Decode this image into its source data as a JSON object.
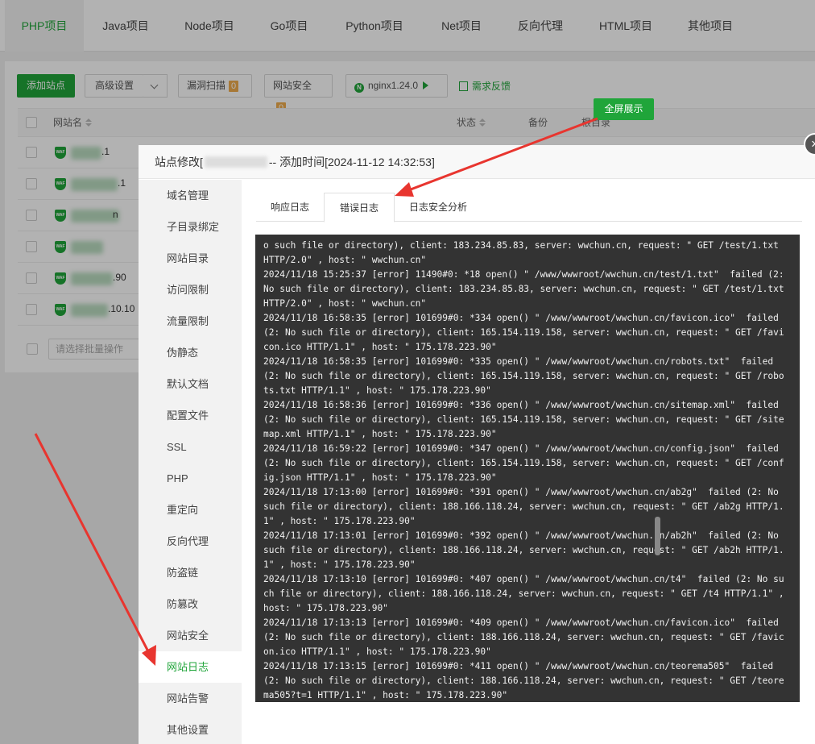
{
  "top_tabs": [
    {
      "label": "PHP项目"
    },
    {
      "label": "Java项目"
    },
    {
      "label": "Node项目"
    },
    {
      "label": "Go项目"
    },
    {
      "label": "Python项目"
    },
    {
      "label": "Net项目"
    },
    {
      "label": "反向代理"
    },
    {
      "label": "HTML项目"
    },
    {
      "label": "其他项目"
    }
  ],
  "toolbar": {
    "add_site": "添加站点",
    "advanced": "高级设置",
    "vuln_scan": "漏洞扫描",
    "vuln_count": "0",
    "site_security": "网站安全",
    "security_count": "0",
    "nginx": "nginx1.24.0",
    "feedback": "需求反馈"
  },
  "table_headers": {
    "name": "网站名",
    "status": "状态",
    "backup": "备份",
    "root": "根目录"
  },
  "site_rows": [
    {
      "suffix": ".1"
    },
    {
      "suffix": ".1"
    },
    {
      "suffix": "n"
    },
    {
      "suffix": ""
    },
    {
      "suffix": ".90"
    },
    {
      "suffix": ".10.10"
    }
  ],
  "batch_placeholder": "请选择批量操作",
  "modal": {
    "title_prefix": "站点修改[",
    "title_suffix": "-- 添加时间[2024-11-12 14:32:53]",
    "close_symbol": "×",
    "side_menu": [
      {
        "label": "域名管理"
      },
      {
        "label": "子目录绑定"
      },
      {
        "label": "网站目录"
      },
      {
        "label": "访问限制"
      },
      {
        "label": "流量限制"
      },
      {
        "label": "伪静态"
      },
      {
        "label": "默认文档"
      },
      {
        "label": "配置文件"
      },
      {
        "label": "SSL"
      },
      {
        "label": "PHP"
      },
      {
        "label": "重定向"
      },
      {
        "label": "反向代理"
      },
      {
        "label": "防盗链"
      },
      {
        "label": "防篡改"
      },
      {
        "label": "网站安全"
      },
      {
        "label": "网站日志"
      },
      {
        "label": "网站告警"
      },
      {
        "label": "其他设置"
      }
    ],
    "active_side_item": "网站日志",
    "log_tabs": [
      {
        "label": "响应日志"
      },
      {
        "label": "错误日志"
      },
      {
        "label": "日志安全分析"
      }
    ],
    "fullscreen": "全屏展示",
    "log_lines": [
      "o such file or directory), client: 183.234.85.83, server: wwchun.cn, request: \" GET /test/1.txt HTTP/2.0\" , host: \" wwchun.cn\"",
      "2024/11/18 15:25:37 [error] 11490#0: *18 open() \" /www/wwwroot/wwchun.cn/test/1.txt\"  failed (2: No such file or directory), client: 183.234.85.83, server: wwchun.cn, request: \" GET /test/1.txt HTTP/2.0\" , host: \" wwchun.cn\"",
      "2024/11/18 16:58:35 [error] 101699#0: *334 open() \" /www/wwwroot/wwchun.cn/favicon.ico\"  failed (2: No such file or directory), client: 165.154.119.158, server: wwchun.cn, request: \" GET /favicon.ico HTTP/1.1\" , host: \" 175.178.223.90\"",
      "2024/11/18 16:58:35 [error] 101699#0: *335 open() \" /www/wwwroot/wwchun.cn/robots.txt\"  failed (2: No such file or directory), client: 165.154.119.158, server: wwchun.cn, request: \" GET /robots.txt HTTP/1.1\" , host: \" 175.178.223.90\"",
      "2024/11/18 16:58:36 [error] 101699#0: *336 open() \" /www/wwwroot/wwchun.cn/sitemap.xml\"  failed (2: No such file or directory), client: 165.154.119.158, server: wwchun.cn, request: \" GET /sitemap.xml HTTP/1.1\" , host: \" 175.178.223.90\"",
      "2024/11/18 16:59:22 [error] 101699#0: *347 open() \" /www/wwwroot/wwchun.cn/config.json\"  failed (2: No such file or directory), client: 165.154.119.158, server: wwchun.cn, request: \" GET /config.json HTTP/1.1\" , host: \" 175.178.223.90\"",
      "2024/11/18 17:13:00 [error] 101699#0: *391 open() \" /www/wwwroot/wwchun.cn/ab2g\"  failed (2: No such file or directory), client: 188.166.118.24, server: wwchun.cn, request: \" GET /ab2g HTTP/1.1\" , host: \" 175.178.223.90\"",
      "2024/11/18 17:13:01 [error] 101699#0: *392 open() \" /www/wwwroot/wwchun.cn/ab2h\"  failed (2: No such file or directory), client: 188.166.118.24, server: wwchun.cn, request: \" GET /ab2h HTTP/1.1\" , host: \" 175.178.223.90\"",
      "2024/11/18 17:13:10 [error] 101699#0: *407 open() \" /www/wwwroot/wwchun.cn/t4\"  failed (2: No such file or directory), client: 188.166.118.24, server: wwchun.cn, request: \" GET /t4 HTTP/1.1\" , host: \" 175.178.223.90\"",
      "2024/11/18 17:13:13 [error] 101699#0: *409 open() \" /www/wwwroot/wwchun.cn/favicon.ico\"  failed (2: No such file or directory), client: 188.166.118.24, server: wwchun.cn, request: \" GET /favicon.ico HTTP/1.1\" , host: \" 175.178.223.90\"",
      "2024/11/18 17:13:15 [error] 101699#0: *411 open() \" /www/wwwroot/wwchun.cn/teorema505\"  failed (2: No such file or directory), client: 188.166.118.24, server: wwchun.cn, request: \" GET /teorema505?t=1 HTTP/1.1\" , host: \" 175.178.223.90\""
    ]
  },
  "colors": {
    "accent": "#20a53a",
    "badge": "#f0ad4e",
    "log_bg": "#333333",
    "arrow": "#e8352f"
  }
}
